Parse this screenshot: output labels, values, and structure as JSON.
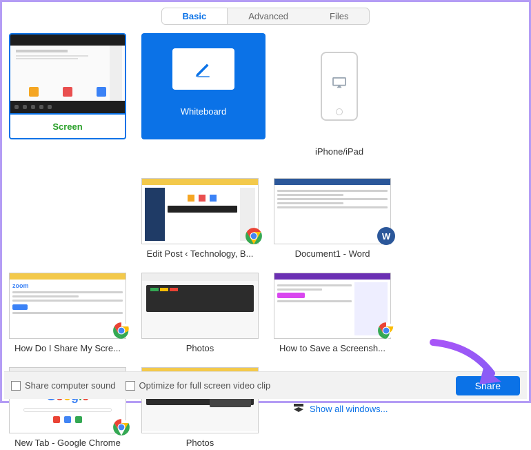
{
  "tabs": {
    "basic": "Basic",
    "advanced": "Advanced",
    "files": "Files",
    "active": "basic"
  },
  "primary_tiles": {
    "screen": {
      "label": "Screen"
    },
    "whiteboard": {
      "label": "Whiteboard"
    },
    "iphone": {
      "label": "iPhone/iPad"
    }
  },
  "windows": [
    {
      "label": "Edit Post ‹ Technology, B...",
      "app": "chrome"
    },
    {
      "label": "Document1 - Word",
      "app": "word"
    },
    {
      "label": "How Do I Share My Scre...",
      "app": "chrome"
    },
    {
      "label": "Photos",
      "app": "photos"
    },
    {
      "label": "How to Save a Screensh...",
      "app": "chrome"
    },
    {
      "label": "New Tab - Google Chrome",
      "app": "chrome"
    },
    {
      "label": "Photos",
      "app": "photos"
    }
  ],
  "show_all": "Show all windows...",
  "footer": {
    "share_sound": "Share computer sound",
    "optimize": "Optimize for full screen video clip",
    "share_btn": "Share"
  },
  "icons": {
    "chrome": "chrome-icon",
    "word": "word-icon",
    "photos": "photos-icon",
    "pencil": "pencil-icon",
    "airplay": "airplay-icon"
  }
}
